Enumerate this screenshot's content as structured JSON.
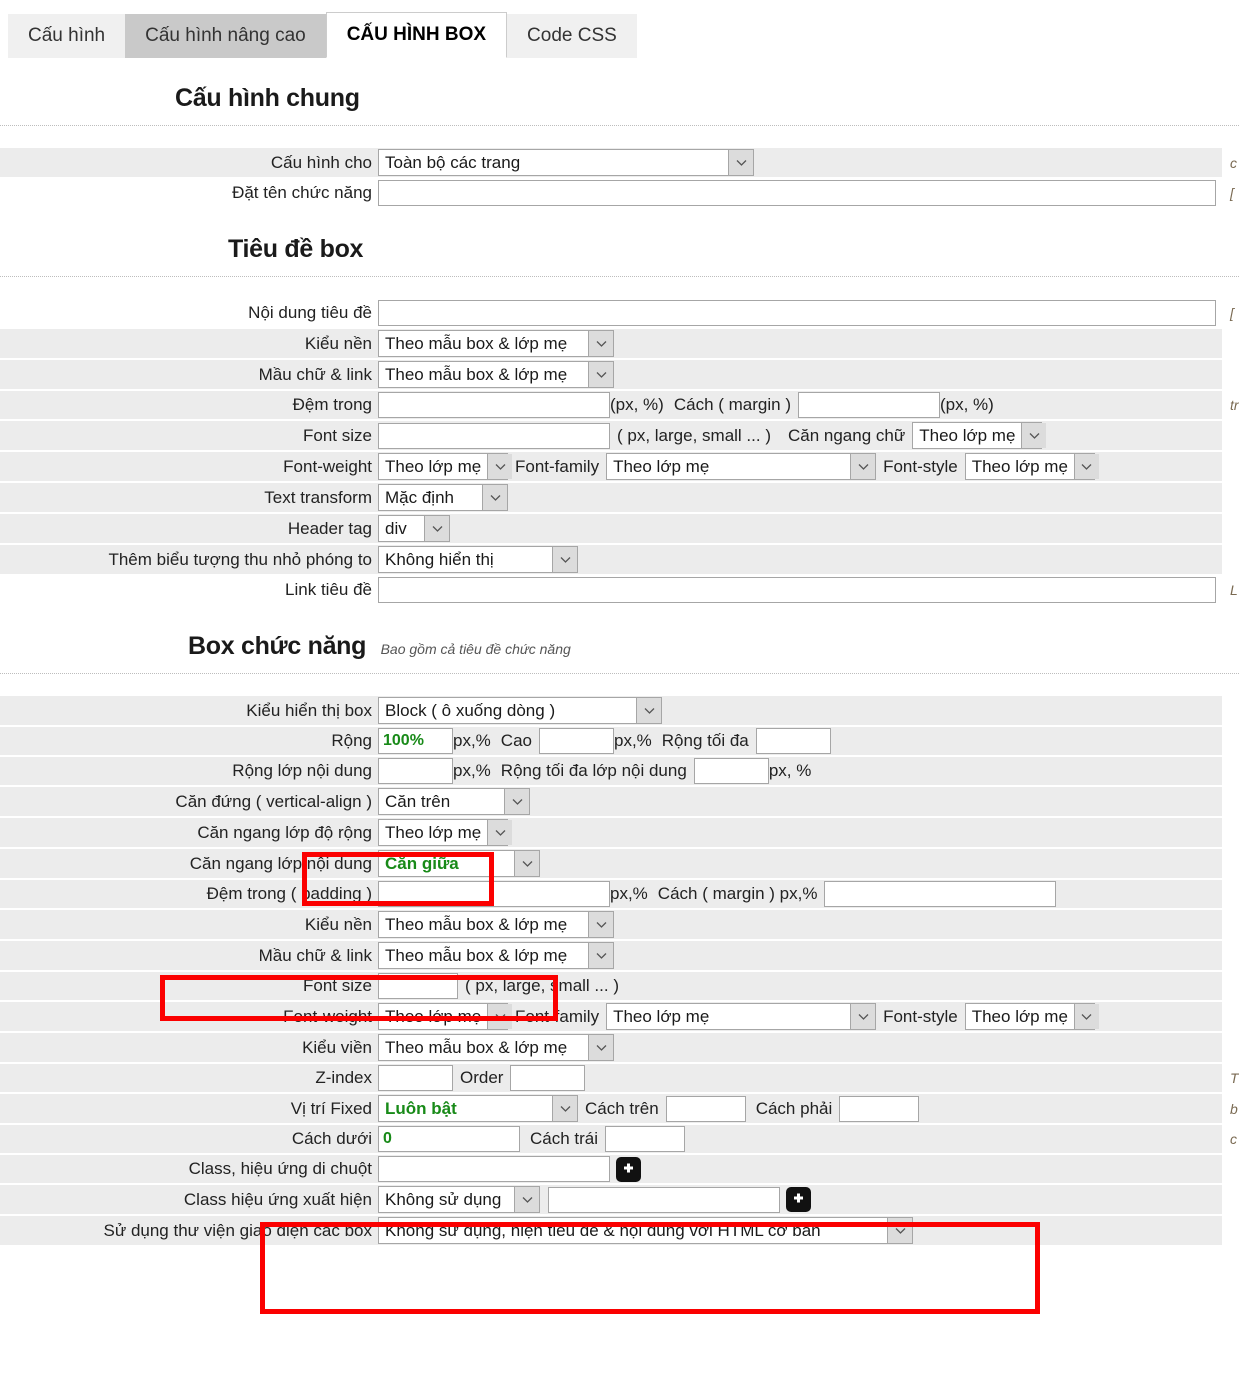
{
  "tabs": [
    {
      "label": "Cấu hình",
      "state": "inactive"
    },
    {
      "label": "Cấu hình nâng cao",
      "state": "hover"
    },
    {
      "label": "CẤU HÌNH BOX",
      "state": "active"
    },
    {
      "label": "Code CSS",
      "state": "inactive"
    }
  ],
  "sections": {
    "general": {
      "title": "Cấu hình chung",
      "rows": {
        "config_for": {
          "label": "Cấu hình cho",
          "value": "Toàn bộ các trang",
          "hint": "c"
        },
        "function_name": {
          "label": "Đặt tên chức năng",
          "value": "",
          "hint": "["
        }
      }
    },
    "box_title": {
      "title": "Tiêu đề box",
      "rows": {
        "title_content": {
          "label": "Nội dung tiêu đề",
          "value": "",
          "hint": "["
        },
        "bg_style": {
          "label": "Kiểu nền",
          "value": "Theo mẫu box & lớp mẹ"
        },
        "text_link_color": {
          "label": "Mầu chữ & link",
          "value": "Theo mẫu box & lớp mẹ"
        },
        "padding": {
          "label": "Đệm trong",
          "value": "",
          "unit": "(px, %)",
          "margin_label": "Cách ( margin )",
          "margin_value": "",
          "margin_unit": "(px, %)",
          "hint": "tr"
        },
        "font_size": {
          "label": "Font size",
          "value": "",
          "unit": "( px, large, small ... )",
          "align_label": "Căn ngang chữ",
          "align_value": "Theo lớp mẹ"
        },
        "font_weight": {
          "label": "Font-weight",
          "value": "Theo lớp mẹ",
          "family_label": "Font-family",
          "family_value": "Theo lớp mẹ",
          "style_label": "Font-style",
          "style_value": "Theo lớp mẹ"
        },
        "text_transform": {
          "label": "Text transform",
          "value": "Mặc định"
        },
        "header_tag": {
          "label": "Header tag",
          "value": "div"
        },
        "zoom_icon": {
          "label": "Thêm biểu tượng thu nhỏ phóng to",
          "value": "Không hiển thị"
        },
        "title_link": {
          "label": "Link tiêu đề",
          "value": "",
          "hint": "L"
        }
      }
    },
    "function_box": {
      "title": "Box chức năng",
      "subtitle": "Bao gồm cả tiêu đề chức năng",
      "rows": {
        "display_type": {
          "label": "Kiểu hiển thị box",
          "value": "Block ( ô xuống dòng )"
        },
        "width": {
          "label": "Rộng",
          "value": "100%",
          "unit": "px,%",
          "height_label": "Cao",
          "height_value": "",
          "height_unit": "px,%",
          "maxw_label": "Rộng tối đa",
          "maxw_value": ""
        },
        "content_width": {
          "label": "Rộng lớp nội dung",
          "value": "",
          "unit": "px,%",
          "max_label": "Rộng tối đa lớp nội dung",
          "max_value": "",
          "max_unit": "px, %"
        },
        "valign": {
          "label": "Căn đứng ( vertical-align )",
          "value": "Căn trên"
        },
        "halign_width": {
          "label": "Căn ngang lớp độ rộng",
          "value": "Theo lớp mẹ"
        },
        "halign_content": {
          "label": "Căn ngang lớp nội dung",
          "value": "Căn giữa"
        },
        "padding": {
          "label": "Đệm trong ( padding )",
          "value": "",
          "unit": "px,%",
          "margin_label": "Cách ( margin ) px,%",
          "margin_value": ""
        },
        "bg_style": {
          "label": "Kiểu nền",
          "value": "Theo mẫu box & lớp mẹ"
        },
        "text_link_color": {
          "label": "Mầu chữ & link",
          "value": "Theo mẫu box & lớp mẹ"
        },
        "font_size": {
          "label": "Font size",
          "value": "",
          "unit": "( px, large, small ... )"
        },
        "font_weight": {
          "label": "Font-weight",
          "value": "Theo lớp mẹ",
          "family_label": "Font-family",
          "family_value": "Theo lớp mẹ",
          "style_label": "Font-style",
          "style_value": "Theo lớp mẹ"
        },
        "border_style": {
          "label": "Kiểu viền",
          "value": "Theo mẫu box & lớp mẹ"
        },
        "zindex": {
          "label": "Z-index",
          "value": "",
          "order_label": "Order",
          "order_value": "",
          "hint": "T"
        },
        "fixed": {
          "label": "Vị trí Fixed",
          "value": "Luôn bật",
          "top_label": "Cách trên",
          "top_value": "",
          "right_label": "Cách phải",
          "right_value": "",
          "bottom_label": "Cách dưới",
          "bottom_value": "0",
          "left_label": "Cách trái",
          "left_value": "",
          "hint_b": "b",
          "hint_c": "c"
        },
        "hover_class": {
          "label": "Class, hiệu ứng di chuột",
          "value": "",
          "add_icon": "plus-icon"
        },
        "appear_class": {
          "label": "Class hiệu ứng xuất hiện",
          "value": "Không sử dụng",
          "text_value": "",
          "add_icon": "plus-icon"
        },
        "ui_library": {
          "label": "Sử dụng thư viện giao diện các box",
          "value": "Không sử dụng, hiện tiêu đề & nội dung với HTML cơ bản"
        }
      }
    }
  },
  "annotations": {
    "accent_color": "#fb0000",
    "highlight_color": "#188a18",
    "boxes": [
      {
        "name": "width-highlight"
      },
      {
        "name": "content-align-highlight"
      },
      {
        "name": "fixed-position-highlight"
      }
    ]
  }
}
